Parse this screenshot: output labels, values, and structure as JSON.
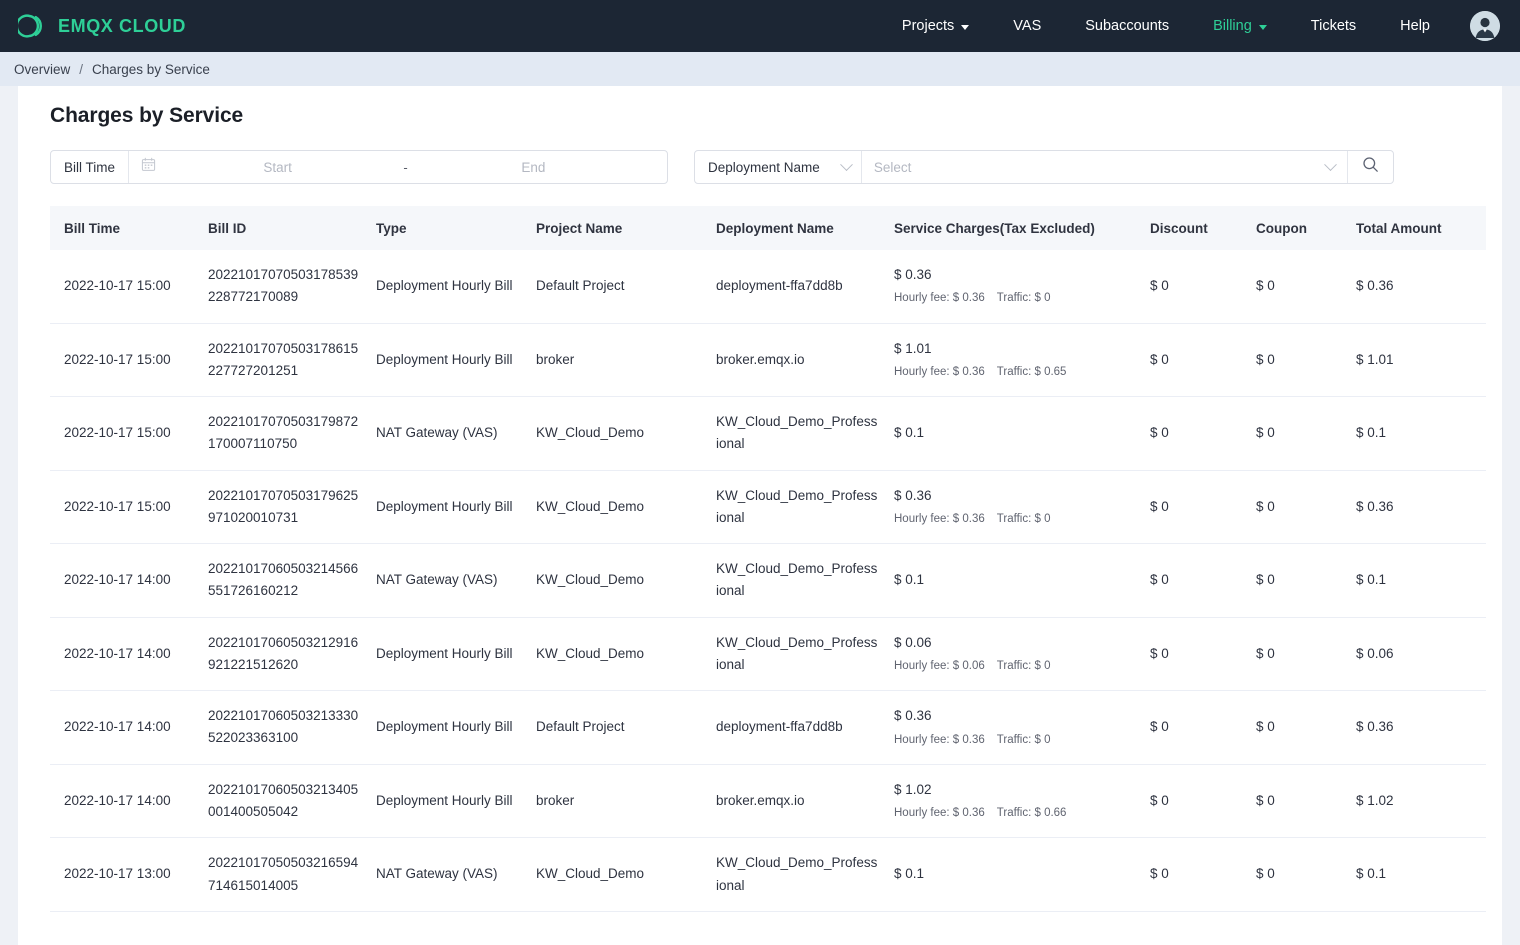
{
  "brand": {
    "name": "EMQX CLOUD",
    "logo_icon": "emqx-logo-icon",
    "accent": "#2ecf97"
  },
  "nav": {
    "items": [
      {
        "label": "Projects",
        "has_caret": true,
        "active": false
      },
      {
        "label": "VAS",
        "has_caret": false,
        "active": false
      },
      {
        "label": "Subaccounts",
        "has_caret": false,
        "active": false
      },
      {
        "label": "Billing",
        "has_caret": true,
        "active": true
      },
      {
        "label": "Tickets",
        "has_caret": false,
        "active": false
      },
      {
        "label": "Help",
        "has_caret": false,
        "active": false
      }
    ],
    "avatar_icon": "user-avatar-icon"
  },
  "breadcrumb": {
    "parent": "Overview",
    "separator": "/",
    "current": "Charges by Service"
  },
  "page": {
    "title": "Charges by Service"
  },
  "filters": {
    "bill_time_label": "Bill Time",
    "calendar_icon": "calendar-icon",
    "start_placeholder": "Start",
    "range_separator": "-",
    "end_placeholder": "End",
    "deployment_label": "Deployment Name",
    "deployment_select_placeholder": "Select",
    "search_icon": "search-icon",
    "chevron_icon": "chevron-down-icon"
  },
  "table": {
    "columns": [
      "Bill Time",
      "Bill ID",
      "Type",
      "Project Name",
      "Deployment Name",
      "Service Charges(Tax Excluded)",
      "Discount",
      "Coupon",
      "Total Amount"
    ],
    "rows": [
      {
        "bill_time": "2022-10-17 15:00",
        "bill_id": "20221017070503178539228772170089",
        "type": "Deployment Hourly Bill",
        "project_name": "Default Project",
        "deployment_name": "deployment-ffa7dd8b",
        "charges": "$ 0.36",
        "hourly_fee": "Hourly fee: $ 0.36",
        "traffic": "Traffic: $ 0",
        "discount": "$ 0",
        "coupon": "$ 0",
        "total": "$ 0.36"
      },
      {
        "bill_time": "2022-10-17 15:00",
        "bill_id": "20221017070503178615227727201251",
        "type": "Deployment Hourly Bill",
        "project_name": "broker",
        "deployment_name": "broker.emqx.io",
        "charges": "$ 1.01",
        "hourly_fee": "Hourly fee: $ 0.36",
        "traffic": "Traffic: $ 0.65",
        "discount": "$ 0",
        "coupon": "$ 0",
        "total": "$ 1.01"
      },
      {
        "bill_time": "2022-10-17 15:00",
        "bill_id": "20221017070503179872170007110750",
        "type": "NAT Gateway (VAS)",
        "project_name": "KW_Cloud_Demo",
        "deployment_name": "KW_Cloud_Demo_Professional",
        "charges": "$ 0.1",
        "hourly_fee": "",
        "traffic": "",
        "discount": "$ 0",
        "coupon": "$ 0",
        "total": "$ 0.1"
      },
      {
        "bill_time": "2022-10-17 15:00",
        "bill_id": "20221017070503179625971020010731",
        "type": "Deployment Hourly Bill",
        "project_name": "KW_Cloud_Demo",
        "deployment_name": "KW_Cloud_Demo_Professional",
        "charges": "$ 0.36",
        "hourly_fee": "Hourly fee: $ 0.36",
        "traffic": "Traffic: $ 0",
        "discount": "$ 0",
        "coupon": "$ 0",
        "total": "$ 0.36"
      },
      {
        "bill_time": "2022-10-17 14:00",
        "bill_id": "20221017060503214566551726160212",
        "type": "NAT Gateway (VAS)",
        "project_name": "KW_Cloud_Demo",
        "deployment_name": "KW_Cloud_Demo_Professional",
        "charges": "$ 0.1",
        "hourly_fee": "",
        "traffic": "",
        "discount": "$ 0",
        "coupon": "$ 0",
        "total": "$ 0.1"
      },
      {
        "bill_time": "2022-10-17 14:00",
        "bill_id": "20221017060503212916921221512620",
        "type": "Deployment Hourly Bill",
        "project_name": "KW_Cloud_Demo",
        "deployment_name": "KW_Cloud_Demo_Professional",
        "charges": "$ 0.06",
        "hourly_fee": "Hourly fee: $ 0.06",
        "traffic": "Traffic: $ 0",
        "discount": "$ 0",
        "coupon": "$ 0",
        "total": "$ 0.06"
      },
      {
        "bill_time": "2022-10-17 14:00",
        "bill_id": "20221017060503213330522023363100",
        "type": "Deployment Hourly Bill",
        "project_name": "Default Project",
        "deployment_name": "deployment-ffa7dd8b",
        "charges": "$ 0.36",
        "hourly_fee": "Hourly fee: $ 0.36",
        "traffic": "Traffic: $ 0",
        "discount": "$ 0",
        "coupon": "$ 0",
        "total": "$ 0.36"
      },
      {
        "bill_time": "2022-10-17 14:00",
        "bill_id": "20221017060503213405001400505042",
        "type": "Deployment Hourly Bill",
        "project_name": "broker",
        "deployment_name": "broker.emqx.io",
        "charges": "$ 1.02",
        "hourly_fee": "Hourly fee: $ 0.36",
        "traffic": "Traffic: $ 0.66",
        "discount": "$ 0",
        "coupon": "$ 0",
        "total": "$ 1.02"
      },
      {
        "bill_time": "2022-10-17 13:00",
        "bill_id": "20221017050503216594714615014005",
        "type": "NAT Gateway (VAS)",
        "project_name": "KW_Cloud_Demo",
        "deployment_name": "KW_Cloud_Demo_Professional",
        "charges": "$ 0.1",
        "hourly_fee": "",
        "traffic": "",
        "discount": "$ 0",
        "coupon": "$ 0",
        "total": "$ 0.1"
      }
    ]
  }
}
